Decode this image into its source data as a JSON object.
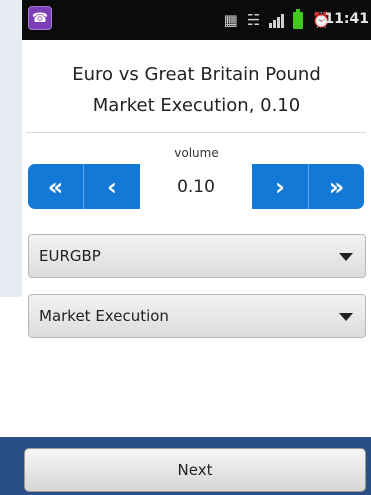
{
  "status_bar": {
    "time": "11:41",
    "icons": [
      "app-viber-icon",
      "vibrate-icon",
      "wifi-icon",
      "signal-icon",
      "battery-icon",
      "alarm-icon"
    ]
  },
  "header": {
    "title_line1": "Euro vs Great Britain Pound",
    "title_line2": "Market Execution, 0.10"
  },
  "volume": {
    "label": "volume",
    "value": "0.10",
    "btn_fast_decrease": "«",
    "btn_decrease": "‹",
    "btn_increase": "›",
    "btn_fast_increase": "»"
  },
  "symbol_select": {
    "selected": "EURGBP"
  },
  "execution_select": {
    "selected": "Market Execution"
  },
  "footer": {
    "next_label": "Next"
  },
  "colors": {
    "accent": "#1478d6",
    "status_bar_bg": "#0b0b0b",
    "bottom_bar_bg": "#2a4f87",
    "battery": "#43c81f"
  }
}
